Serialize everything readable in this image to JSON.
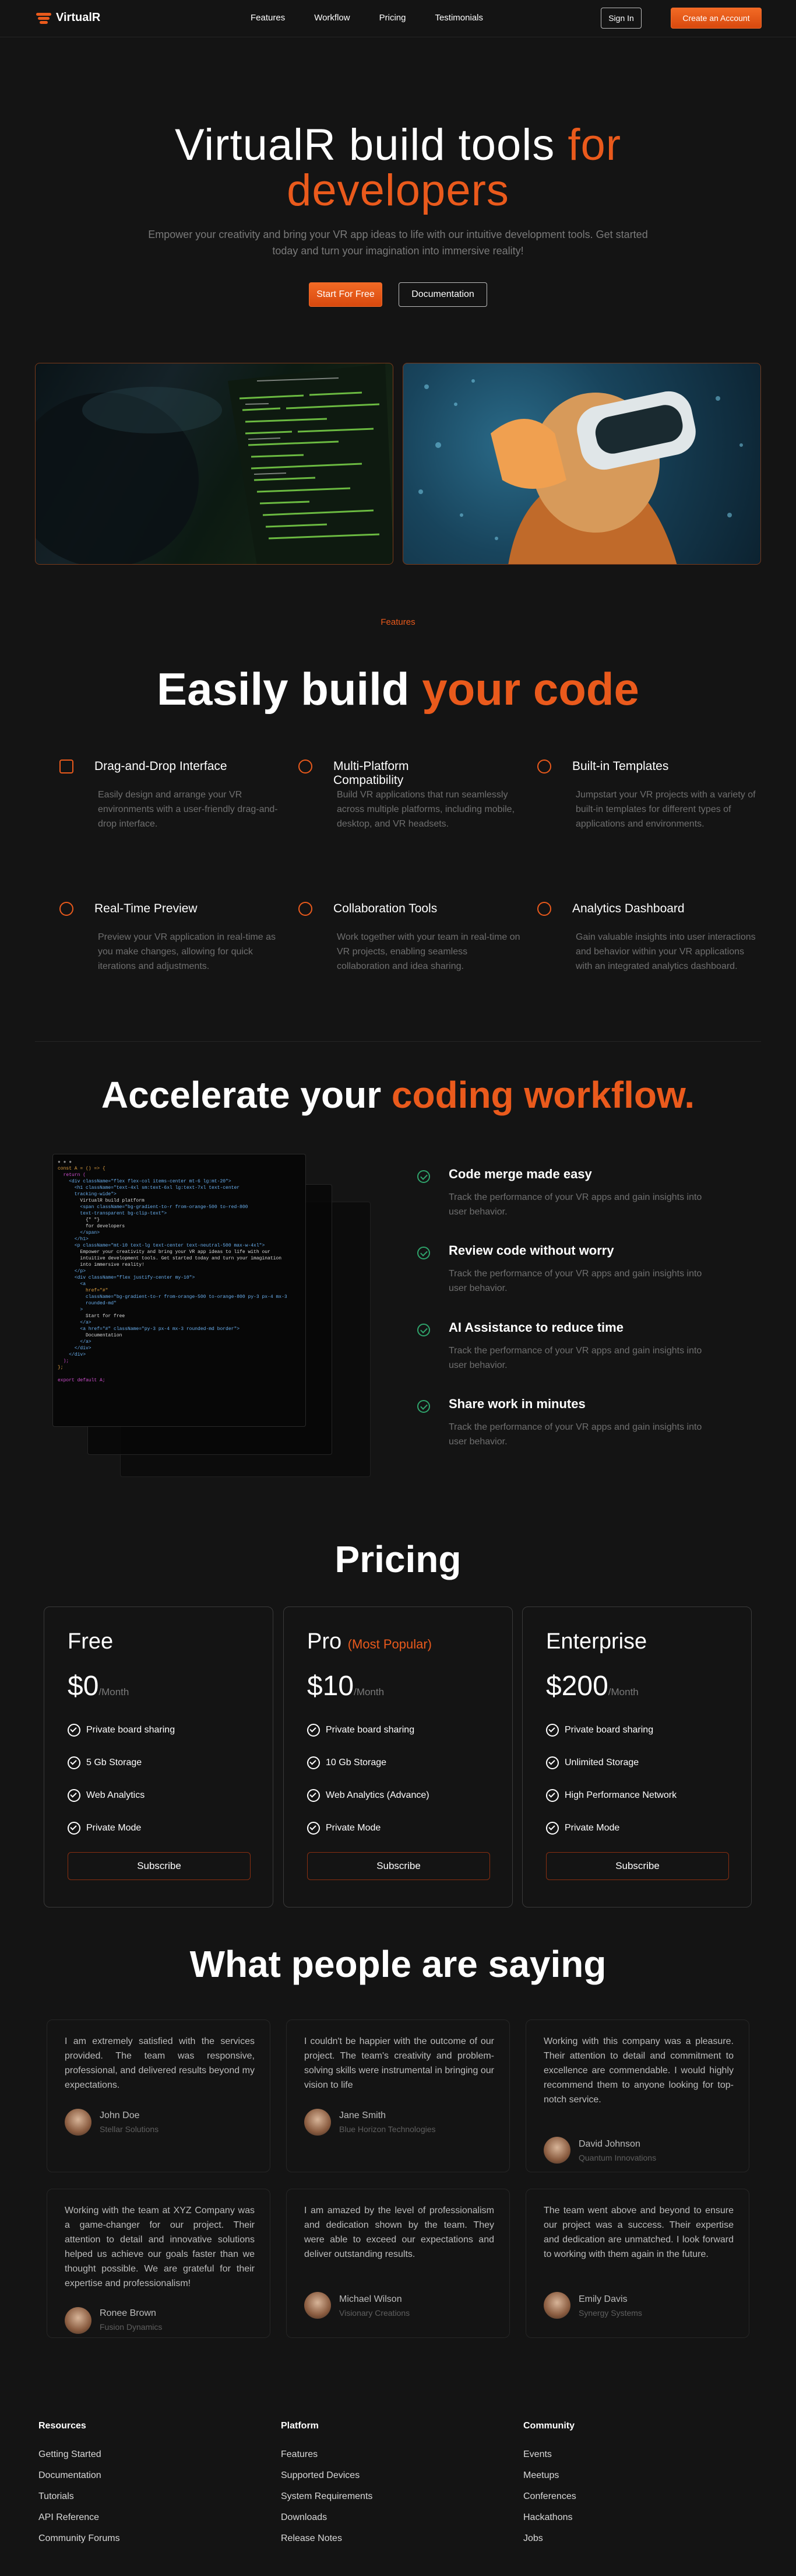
{
  "header": {
    "brand": "VirtualR",
    "nav": [
      "Features",
      "Workflow",
      "Pricing",
      "Testimonials"
    ],
    "signin": "Sign In",
    "create": "Create an Account"
  },
  "hero": {
    "title_1": "VirtualR build tools",
    "title_accent_1": "for",
    "title_accent_2": "developers",
    "subtitle": "Empower your creativity and bring your VR app ideas to life with our intuitive development tools. Get started today and turn your imagination into immersive reality!",
    "start": "Start For Free",
    "docs": "Documentation"
  },
  "features": {
    "tag": "Features",
    "title_1": "Easily build",
    "title_accent": "your code",
    "items": [
      {
        "name": "Drag-and-Drop Interface",
        "desc": "Easily design and arrange your VR environments with a user-friendly drag-and-drop interface.",
        "icon": "drag-drop-icon"
      },
      {
        "name": "Multi-Platform Compatibility",
        "desc": "Build VR applications that run seamlessly across multiple platforms, including mobile, desktop, and VR headsets.",
        "icon": "globe-icon"
      },
      {
        "name": "Built-in Templates",
        "desc": "Jumpstart your VR projects with a variety of built-in templates for different types of applications and environments.",
        "icon": "template-icon"
      },
      {
        "name": "Real-Time Preview",
        "desc": "Preview your VR application in real-time as you make changes, allowing for quick iterations and adjustments.",
        "icon": "preview-icon"
      },
      {
        "name": "Collaboration Tools",
        "desc": "Work together with your team in real-time on VR projects, enabling seamless collaboration and idea sharing.",
        "icon": "collaboration-icon"
      },
      {
        "name": "Analytics Dashboard",
        "desc": "Gain valuable insights into user interactions and behavior within your VR applications with an integrated analytics dashboard.",
        "icon": "analytics-icon"
      }
    ]
  },
  "workflow": {
    "title_1": "Accelerate your",
    "title_accent": "coding workflow.",
    "items": [
      {
        "title": "Code merge made easy",
        "desc": "Track the performance of your VR apps and gain insights into user behavior."
      },
      {
        "title": "Review code without worry",
        "desc": "Track the performance of your VR apps and gain insights into user behavior."
      },
      {
        "title": "AI Assistance to reduce time",
        "desc": "Track the performance of your VR apps and gain insights into user behavior."
      },
      {
        "title": "Share work in minutes",
        "desc": "Track the performance of your VR apps and gain insights into user behavior."
      }
    ]
  },
  "pricing": {
    "title": "Pricing",
    "popular": "(Most Popular)",
    "period": "/Month",
    "subscribe": "Subscribe",
    "plans": [
      {
        "name": "Free",
        "price": "$0",
        "features": [
          "Private board sharing",
          "5 Gb Storage",
          "Web Analytics",
          "Private Mode"
        ]
      },
      {
        "name": "Pro",
        "price": "$10",
        "features": [
          "Private board sharing",
          "10 Gb Storage",
          "Web Analytics (Advance)",
          "Private Mode"
        ]
      },
      {
        "name": "Enterprise",
        "price": "$200",
        "features": [
          "Private board sharing",
          "Unlimited Storage",
          "High Performance Network",
          "Private Mode"
        ]
      }
    ]
  },
  "testimonials": {
    "title": "What people are saying",
    "items": [
      {
        "quote": "I am extremely satisfied with the services provided. The team was responsive, professional, and delivered results beyond my expectations.",
        "name": "John Doe",
        "company": "Stellar Solutions"
      },
      {
        "quote": "I couldn't be happier with the outcome of our project. The team's creativity and problem-solving skills were instrumental in bringing our vision to life",
        "name": "Jane Smith",
        "company": "Blue Horizon Technologies"
      },
      {
        "quote": "Working with this company was a pleasure. Their attention to detail and commitment to excellence are commendable. I would highly recommend them to anyone looking for top-notch service.",
        "name": "David Johnson",
        "company": "Quantum Innovations"
      },
      {
        "quote": "Working with the team at XYZ Company was a game-changer for our project. Their attention to detail and innovative solutions helped us achieve our goals faster than we thought possible. We are grateful for their expertise and professionalism!",
        "name": "Ronee Brown",
        "company": "Fusion Dynamics"
      },
      {
        "quote": "I am amazed by the level of professionalism and dedication shown by the team. They were able to exceed our expectations and deliver outstanding results.",
        "name": "Michael Wilson",
        "company": "Visionary Creations"
      },
      {
        "quote": "The team went above and beyond to ensure our project was a success. Their expertise and dedication are unmatched. I look forward to working with them again in the future.",
        "name": "Emily Davis",
        "company": "Synergy Systems"
      }
    ]
  },
  "footer": {
    "columns": [
      {
        "title": "Resources",
        "links": [
          "Getting Started",
          "Documentation",
          "Tutorials",
          "API Reference",
          "Community Forums"
        ]
      },
      {
        "title": "Platform",
        "links": [
          "Features",
          "Supported Devices",
          "System Requirements",
          "Downloads",
          "Release Notes"
        ]
      },
      {
        "title": "Community",
        "links": [
          "Events",
          "Meetups",
          "Conferences",
          "Hackathons",
          "Jobs"
        ]
      }
    ]
  },
  "colors": {
    "accent": "#ea5a1c",
    "background": "#141414",
    "check": "#2fa36b"
  }
}
